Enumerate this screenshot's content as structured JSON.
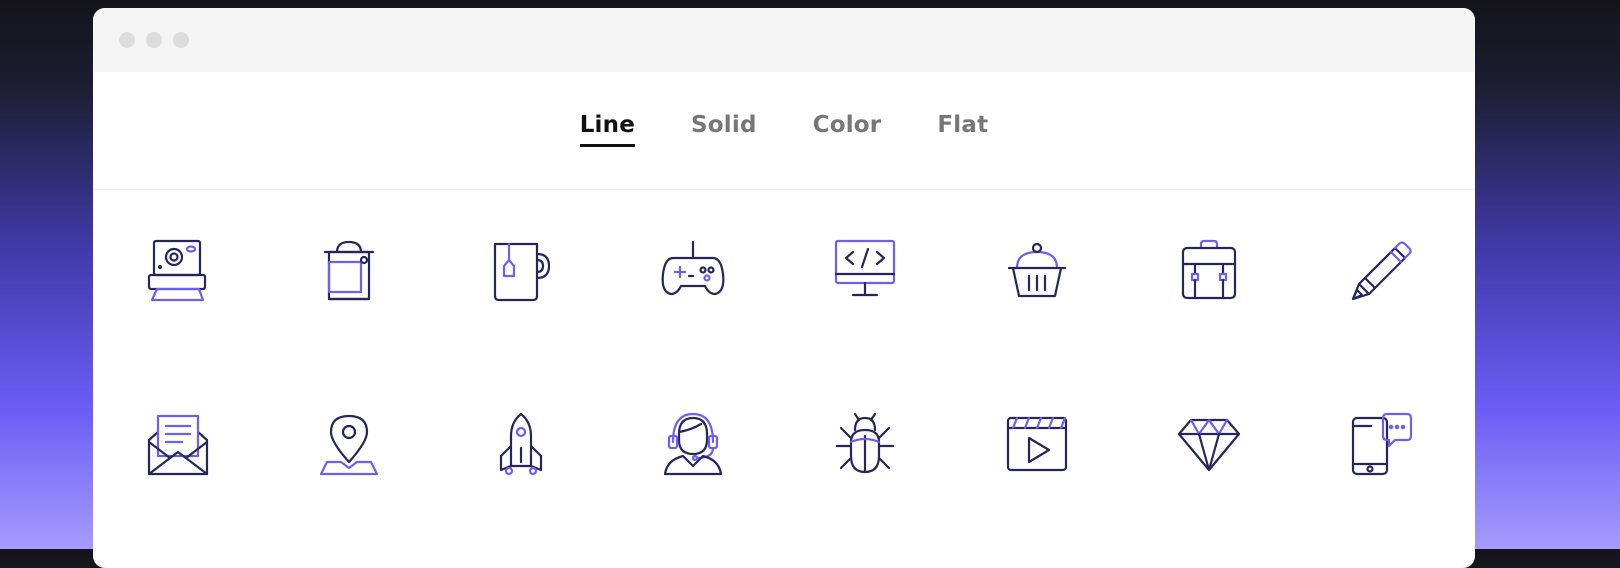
{
  "colors": {
    "dark_stroke": "#27265a",
    "accent_stroke": "#6f5ff0",
    "active_tab": "#111111",
    "inactive_tab": "#777777"
  },
  "window": {
    "controls": [
      "close",
      "minimize",
      "maximize"
    ]
  },
  "tabs": [
    {
      "label": "Line",
      "active": true
    },
    {
      "label": "Solid",
      "active": false
    },
    {
      "label": "Color",
      "active": false
    },
    {
      "label": "Flat",
      "active": false
    }
  ],
  "icons": {
    "row1": [
      "instant-camera-icon",
      "shopping-bag-icon",
      "tea-mug-icon",
      "gamepad-icon",
      "code-monitor-icon",
      "shopping-basket-icon",
      "backpack-icon",
      "pencil-icon"
    ],
    "row2": [
      "envelope-letter-icon",
      "map-pin-icon",
      "rocket-icon",
      "support-agent-icon",
      "bug-icon",
      "video-player-icon",
      "diamond-icon",
      "phone-chat-icon"
    ]
  }
}
